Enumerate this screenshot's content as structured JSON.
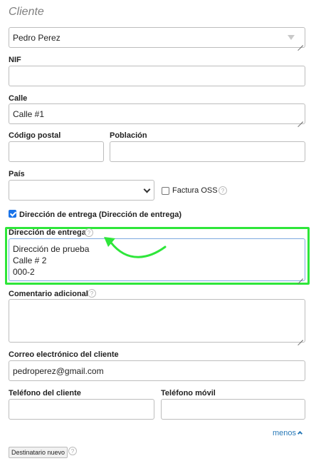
{
  "form": {
    "section_title": "Cliente",
    "client_select": {
      "value": "Pedro Perez"
    },
    "nif": {
      "label": "NIF",
      "value": ""
    },
    "calle": {
      "label": "Calle",
      "value": "Calle #1"
    },
    "codigo_postal": {
      "label": "Código postal",
      "value": ""
    },
    "poblacion": {
      "label": "Población",
      "value": ""
    },
    "pais": {
      "label": "País",
      "value": ""
    },
    "factura_oss": {
      "label": "Factura OSS",
      "checked": false
    },
    "direccion_checkbox": {
      "label": "Dirección de entrega (Dirección de entrega)",
      "checked": true
    },
    "direccion_entrega": {
      "label": "Dirección de entrega",
      "value": "Dirección de prueba\nCalle # 2\n000-2"
    },
    "comentario": {
      "label": "Comentario adicional",
      "value": ""
    },
    "correo": {
      "label": "Correo electrónico del cliente",
      "value": "pedroperez@gmail.com"
    },
    "telefono": {
      "label": "Teléfono del cliente",
      "value": ""
    },
    "movil": {
      "label": "Teléfono móvil",
      "value": ""
    },
    "menos_link": "menos",
    "destinatario_button": "Destinatario nuevo",
    "help_glyph": "?"
  },
  "colors": {
    "highlight": "#2ee63a",
    "link": "#2a7ab8",
    "checkbox": "#1a73e8",
    "section_title": "#808080"
  },
  "icons": {
    "help": "help-icon",
    "arrow": "green-curved-arrow",
    "select": "chevron-down-icon"
  }
}
